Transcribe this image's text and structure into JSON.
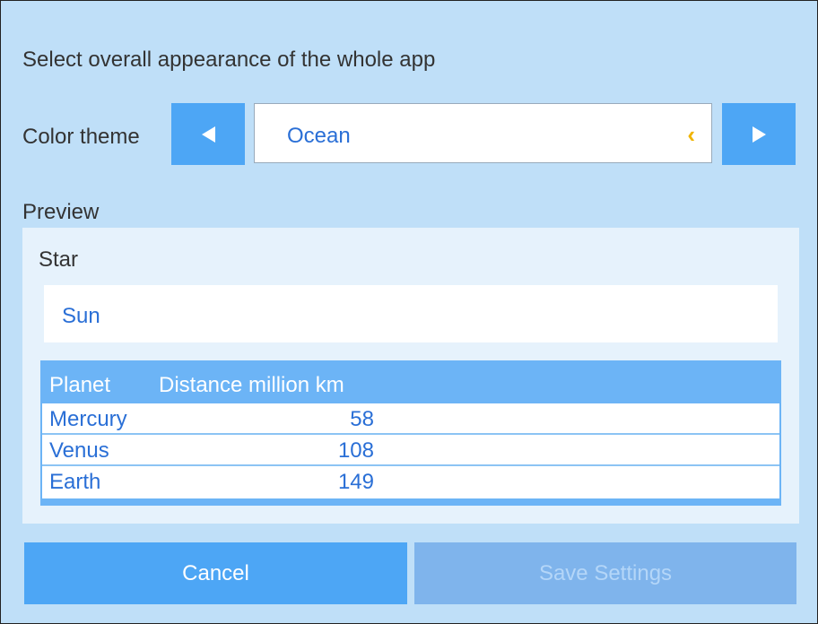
{
  "header": {
    "text": "Select overall appearance of the whole app"
  },
  "theme": {
    "label": "Color theme",
    "value": "Ocean",
    "prev_icon": "triangle-left",
    "next_icon": "triangle-right",
    "changed_marker": "‹",
    "changed_marker_color": "#f0b400"
  },
  "preview": {
    "label": "Preview",
    "star": {
      "label": "Star",
      "value": "Sun"
    },
    "table": {
      "columns": [
        "Planet",
        "Distance million km"
      ],
      "rows": [
        {
          "planet": "Mercury",
          "distance": "58"
        },
        {
          "planet": "Venus",
          "distance": "108"
        },
        {
          "planet": "Earth",
          "distance": "149"
        }
      ]
    }
  },
  "buttons": {
    "cancel": "Cancel",
    "save": "Save Settings"
  },
  "colors": {
    "accent": "#4da6f5",
    "background": "#bfdff8",
    "value_text": "#2a6fd6",
    "disabled_button": "#7fb4ec"
  }
}
